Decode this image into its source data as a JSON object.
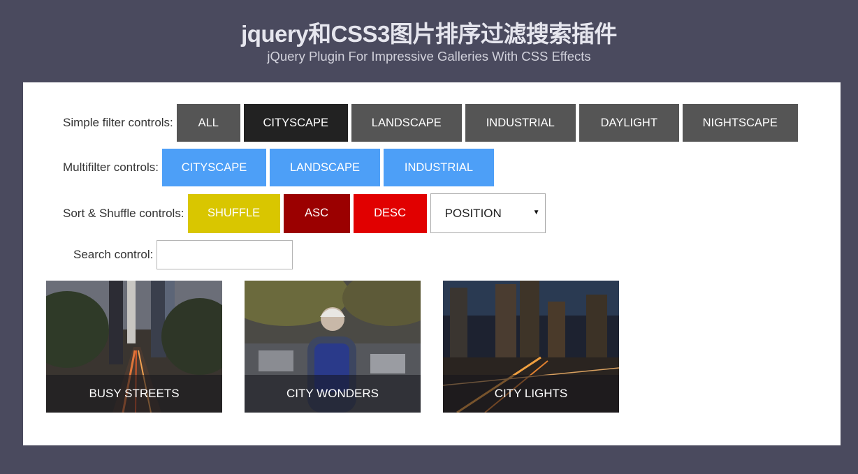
{
  "header": {
    "title": "jquery和CSS3图片排序过滤搜索插件",
    "subtitle": "jQuery Plugin For Impressive Galleries With CSS Effects"
  },
  "simple_filter": {
    "label": "Simple filter controls:",
    "buttons": [
      "ALL",
      "CITYSCAPE",
      "LANDSCAPE",
      "INDUSTRIAL",
      "DAYLIGHT",
      "NIGHTSCAPE"
    ],
    "active": "CITYSCAPE"
  },
  "multi_filter": {
    "label": "Multifilter controls:",
    "buttons": [
      "CITYSCAPE",
      "LANDSCAPE",
      "INDUSTRIAL"
    ]
  },
  "sort": {
    "label": "Sort & Shuffle controls:",
    "shuffle": "SHUFFLE",
    "asc": "ASC",
    "desc": "DESC",
    "select_value": "POSITION"
  },
  "search": {
    "label": "Search control:",
    "value": ""
  },
  "gallery": [
    {
      "caption": "BUSY STREETS"
    },
    {
      "caption": "CITY WONDERS"
    },
    {
      "caption": "CITY LIGHTS"
    }
  ],
  "colors": {
    "background": "#4a4a5e",
    "filter_button": "#555555",
    "filter_active": "#222222",
    "multifilter": "#4d9ff7",
    "shuffle": "#d9c600",
    "asc": "#9b0000",
    "desc": "#e10000"
  }
}
